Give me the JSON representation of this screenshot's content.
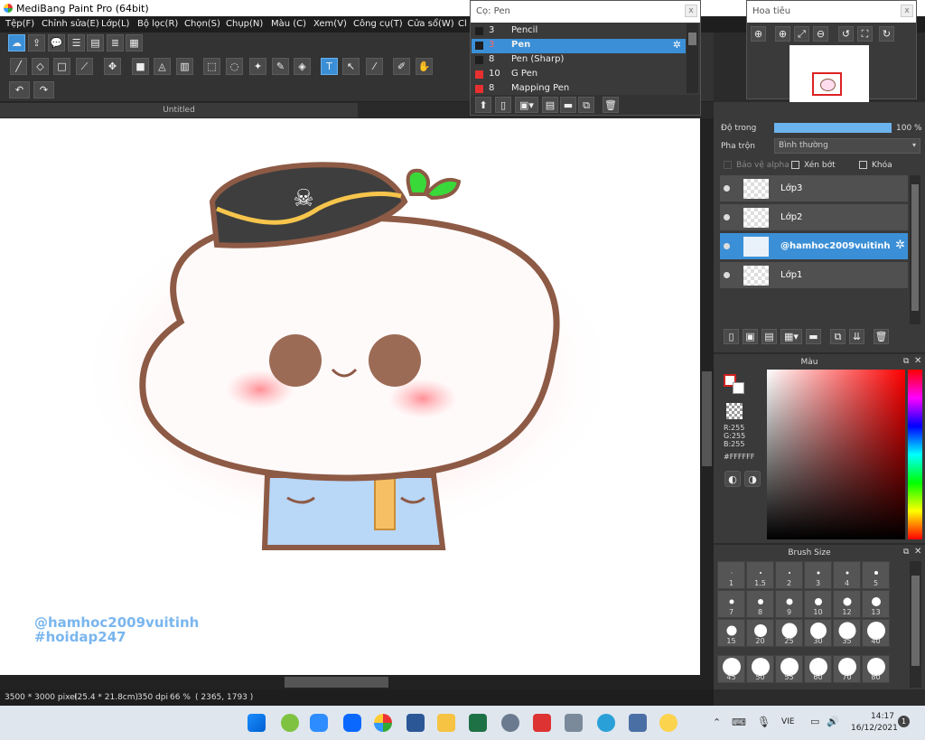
{
  "window": {
    "title": "MediBang Paint Pro (64bit)"
  },
  "menu": [
    "Tệp(F)",
    "Chỉnh sửa(E)",
    "Lớp(L)",
    "Bộ lọc(R)",
    "Chọn(S)",
    "Chụp(N)",
    "Màu (C)",
    "Xem(V)",
    "Công cụ(T)",
    "Cửa sổ(W)",
    "Cl"
  ],
  "canvas": {
    "tab": "Untitled",
    "watermark1": "@hamhoc2009vuitinh",
    "watermark2": "#hoidap247"
  },
  "brush_window": {
    "title": "Cọ: Pen",
    "close": "x",
    "items": [
      {
        "size": "3",
        "name": "Pencil",
        "color": "#1e1e1e"
      },
      {
        "size": "3",
        "name": "Pen",
        "color": "#1e1e1e",
        "selected": true
      },
      {
        "size": "8",
        "name": "Pen (Sharp)",
        "color": "#1e1e1e"
      },
      {
        "size": "10",
        "name": "G Pen",
        "color": "#e83030"
      },
      {
        "size": "8",
        "name": "Mapping Pen",
        "color": "#e83030"
      }
    ]
  },
  "navigator": {
    "title": "Hoa tiêu",
    "close": "x"
  },
  "layer_panel": {
    "opacity_label": "Độ trong",
    "opacity_value": "100 %",
    "blend_label": "Pha trộn",
    "blend_value": "Bình thường",
    "protect_alpha": "Bảo vệ alpha",
    "clipping": "Xén bớt",
    "lock": "Khóa",
    "layers": [
      {
        "name": "Lớp3",
        "selected": false
      },
      {
        "name": "Lớp2",
        "selected": false
      },
      {
        "name": "@hamhoc2009vuitinh",
        "selected": true
      },
      {
        "name": "Lớp1",
        "selected": false
      }
    ]
  },
  "color_panel": {
    "title": "Màu",
    "r": "R:255",
    "g": "G:255",
    "b": "B:255",
    "hex": "#FFFFFF"
  },
  "brush_size_panel": {
    "title": "Brush Size",
    "sizes": [
      "1",
      "1.5",
      "2",
      "3",
      "4",
      "5",
      "7",
      "8",
      "9",
      "10",
      "12",
      "13",
      "15",
      "20",
      "25",
      "30",
      "35",
      "40",
      "45",
      "50",
      "55",
      "60",
      "70",
      "80"
    ]
  },
  "status": {
    "dimensions": "3500 * 3000 pixel",
    "cm": "(25.4 * 21.8cm)",
    "dpi": "350 dpi",
    "zoom": "66 %",
    "coords": "( 2365, 1793 )"
  },
  "taskbar": {
    "lang": "VIE",
    "time": "14:17",
    "date": "16/12/2021",
    "notifications": "1"
  }
}
